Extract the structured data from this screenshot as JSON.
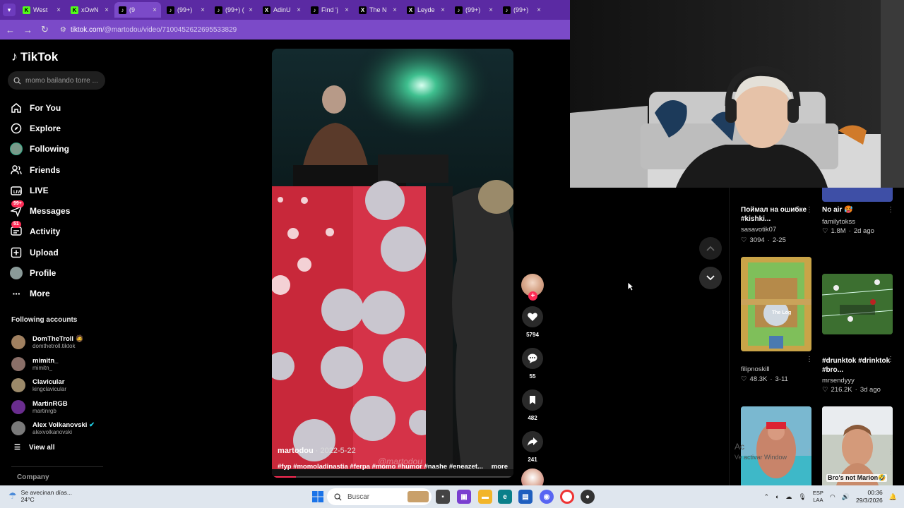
{
  "browser": {
    "tabs": [
      {
        "label": "West",
        "icon": "K",
        "color": "#53fc18"
      },
      {
        "label": "xOwN",
        "icon": "K",
        "color": "#53fc18"
      },
      {
        "label": "(9",
        "icon": "tiktok",
        "color": "#000000",
        "active": true
      },
      {
        "label": "(99+)",
        "icon": "tiktok",
        "color": "#000000"
      },
      {
        "label": "(99+) (",
        "icon": "tiktok",
        "color": "#000000"
      },
      {
        "label": "AdinU",
        "icon": "X",
        "color": "#000000"
      },
      {
        "label": "Find 'j",
        "icon": "tiktok",
        "color": "#000000"
      },
      {
        "label": "The N",
        "icon": "X",
        "color": "#000000"
      },
      {
        "label": "Leyde",
        "icon": "X",
        "color": "#000000"
      },
      {
        "label": "(99+)",
        "icon": "tiktok",
        "color": "#000000"
      },
      {
        "label": "(99+)",
        "icon": "tiktok",
        "color": "#000000"
      }
    ],
    "url_host": "tiktok.com",
    "url_path": "/@martodou/video/7100452622695533829"
  },
  "sidebar": {
    "brand": "TikTok",
    "search_placeholder": "momo bailando torre ...",
    "menu": [
      {
        "label": "For You",
        "icon": "home-icon"
      },
      {
        "label": "Explore",
        "icon": "compass-icon"
      },
      {
        "label": "Following",
        "icon": "following-avatar-icon"
      },
      {
        "label": "Friends",
        "icon": "friends-icon"
      },
      {
        "label": "LIVE",
        "icon": "live-icon"
      },
      {
        "label": "Messages",
        "icon": "messages-icon",
        "badge": "99+"
      },
      {
        "label": "Activity",
        "icon": "activity-icon",
        "badge": "51"
      },
      {
        "label": "Upload",
        "icon": "upload-icon"
      },
      {
        "label": "Profile",
        "icon": "profile-avatar-icon"
      },
      {
        "label": "More",
        "icon": "more-icon"
      }
    ],
    "following_title": "Following accounts",
    "following": [
      {
        "name": "DomTheTroll 🧔",
        "handle": "domthetroll.tiktok",
        "color": "#a08060"
      },
      {
        "name": "mimitn_",
        "handle": "mimitn_",
        "color": "#8a6f68"
      },
      {
        "name": "Clavicular",
        "handle": "kingclavicular",
        "color": "#9c8a6a"
      },
      {
        "name": "MartinRGB",
        "handle": "martinrgb",
        "color": "#6a2d8f"
      },
      {
        "name": "Alex Volkanovski",
        "handle": "alexvolkanovski",
        "color": "#7a7a7a",
        "verified": true
      }
    ],
    "view_all": "View all",
    "company": "Company"
  },
  "video": {
    "author": "martodou",
    "date": "2022-5-22",
    "caption": "#fyp #momoladinastia #ferpa #momo #humor #nashe #eneazet...",
    "more": "more",
    "watermark": "@martodou",
    "progress": 0.1
  },
  "actions": {
    "likes": "5794",
    "comments": "55",
    "saves": "482",
    "shares": "241"
  },
  "recommendations": [
    {
      "title": "Поймал на ошибке #kishki...",
      "author": "sasavotik07",
      "likes": "3094",
      "date": "2-25"
    },
    {
      "title": "No air 🥵",
      "author": "familytokss",
      "likes": "1.8M",
      "date": "2d ago"
    },
    {
      "title": "",
      "author": "filipnoskill",
      "likes": "48.3K",
      "date": "3-11",
      "thumb_text": "The Log"
    },
    {
      "title": "#drunktok #drinktok #bro...",
      "author": "mrsendyyy",
      "likes": "216.2K",
      "date": "3d ago"
    },
    {
      "title": "",
      "author": "",
      "likes": "",
      "date": "",
      "thumb_text": "Bro's not Marion🤣"
    }
  ],
  "activation": {
    "line1": "Ac",
    "line2": "Ve                      activar Window"
  },
  "taskbar": {
    "weather_title": "Se avecinan días...",
    "weather_temp": "24°C",
    "search_label": "Buscar",
    "lang_top": "ESP",
    "lang_bottom": "LAA",
    "time": "00:36",
    "date": "29/3/2026"
  }
}
